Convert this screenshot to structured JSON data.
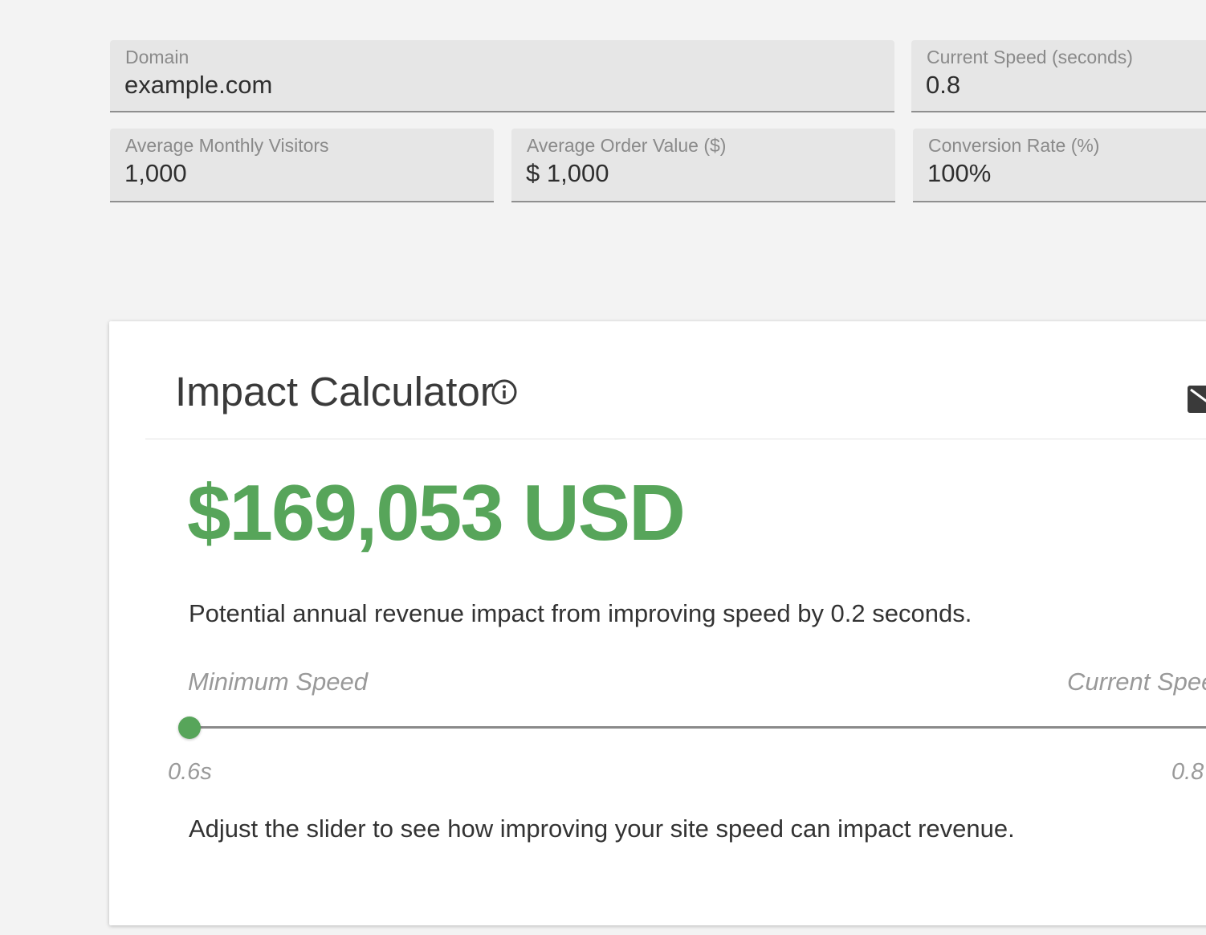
{
  "inputs": {
    "domain": {
      "label": "Domain",
      "value": "example.com"
    },
    "current_speed": {
      "label": "Current Speed (seconds)",
      "value": "0.8"
    },
    "monthly_visitors": {
      "label": "Average Monthly Visitors",
      "value": "1,000"
    },
    "order_value": {
      "label": "Average Order Value ($)",
      "value": "$ 1,000"
    },
    "conversion_rate": {
      "label": "Conversion Rate (%)",
      "value": "100%"
    }
  },
  "calculator": {
    "title": "Impact Calculator",
    "info_icon": "info-circle-icon",
    "email_icon": "envelope-icon",
    "revenue": "$169,053 USD",
    "impact_text": "Potential annual revenue impact from improving speed by 0.2 seconds.",
    "slider": {
      "min_label": "Minimum Speed",
      "current_label": "Current Spee",
      "min_value": "0.6s",
      "current_value": "0.8",
      "position": 0
    },
    "helper_text": "Adjust the slider to see how improving your site speed can impact revenue."
  },
  "colors": {
    "accent_green": "#57a55a",
    "field_background": "#e6e6e6",
    "page_background": "#f3f3f3"
  }
}
